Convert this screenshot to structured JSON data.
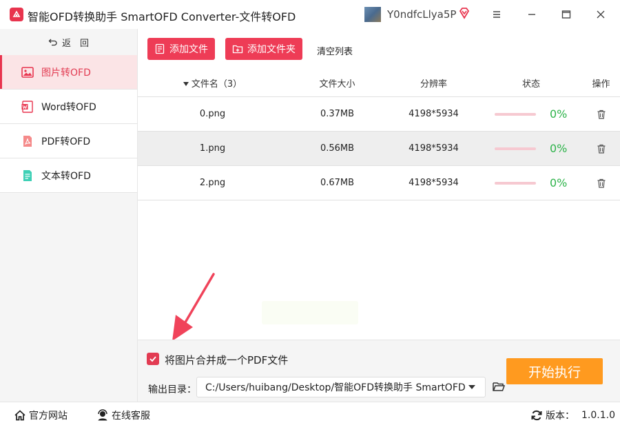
{
  "app": {
    "title": "智能OFD转换助手 SmartOFD Converter-文件转OFD",
    "user_name": "Y0ndfcLlya5P",
    "accent_color": "#e8344e"
  },
  "sidebar": {
    "back_label": "返　回",
    "items": [
      {
        "label": "图片转OFD",
        "icon": "image-icon",
        "active": true
      },
      {
        "label": "Word转OFD",
        "icon": "word-icon",
        "active": false
      },
      {
        "label": "PDF转OFD",
        "icon": "pdf-icon",
        "active": false
      },
      {
        "label": "文本转OFD",
        "icon": "text-file-icon",
        "active": false
      }
    ]
  },
  "toolbar": {
    "add_file_label": "添加文件",
    "add_folder_label": "添加文件夹",
    "clear_label": "清空列表"
  },
  "table": {
    "headers": {
      "name": "文件名（3）",
      "size": "文件大小",
      "resolution": "分辨率",
      "status": "状态",
      "action": "操作"
    },
    "rows": [
      {
        "name": "0.png",
        "size": "0.37MB",
        "resolution": "4198*5934",
        "progress": 0,
        "percent": "0%"
      },
      {
        "name": "1.png",
        "size": "0.56MB",
        "resolution": "4198*5934",
        "progress": 0,
        "percent": "0%"
      },
      {
        "name": "2.png",
        "size": "0.67MB",
        "resolution": "4198*5934",
        "progress": 0,
        "percent": "0%"
      }
    ]
  },
  "bottom": {
    "merge_label": "将图片合并成一个PDF文件",
    "merge_checked": true,
    "output_label": "输出目录：",
    "output_path": "C:/Users/huibang/Desktop/智能OFD转换助手 SmartOFD",
    "start_label": "开始执行",
    "start_color": "#ff9a1f"
  },
  "statusbar": {
    "website_label": "官方网站",
    "service_label": "在线客服",
    "version_label": "版本：",
    "version_value": "1.0.1.0"
  }
}
